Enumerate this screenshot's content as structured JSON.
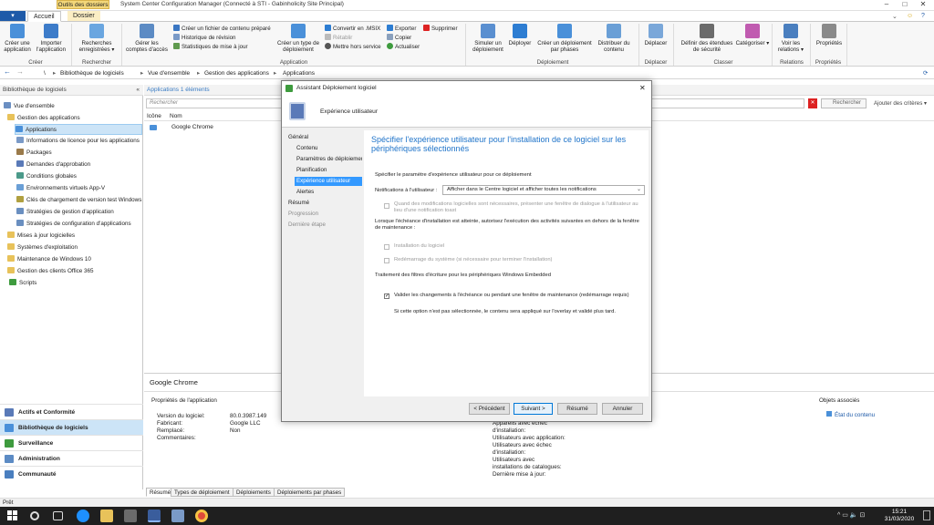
{
  "window": {
    "title": "System Center Configuration Manager (Connecté à STI - Gabinholicity Site Principal)",
    "contextual_tab_header": "Outils des dossiers",
    "controls": [
      "–",
      "□",
      "✕"
    ],
    "help_icons": [
      "⌄",
      "☺",
      "?"
    ]
  },
  "tabs": {
    "menu": "▾",
    "accueil": "Accueil",
    "dossier": "Dossier"
  },
  "ribbon": {
    "creer_application": "Créer une application",
    "importer_application": "Importer l'application",
    "recherches": "Recherches enregistrées ▾",
    "gerer_acces": "Gérer les comptes d'accès",
    "creer_fichier": "Créer un fichier de contenu préparé",
    "historique": "Historique de révision",
    "statistiques": "Statistiques de mise à jour",
    "creer_type": "Créer un type de déploiement",
    "convertir_msix": "Convertir en .MSIX",
    "retablir": "Rétablir",
    "mettre_hors_service": "Mettre hors service",
    "exporter": "Exporter",
    "copier": "Copier",
    "actualiser": "Actualiser",
    "supprimer": "Supprimer",
    "simuler": "Simuler un déploiement",
    "deployer": "Déployer",
    "creer_phases": "Créer un déploiement par phases",
    "distribuer": "Distribuer du contenu",
    "deplacer": "Déplacer",
    "definir_securite": "Définir des étendues de sécurité",
    "categoriser": "Catégoriser ▾",
    "voir_relations": "Voir les relations ▾",
    "proprietes": "Propriétés",
    "groups": {
      "creer": "Créer",
      "rechercher": "Rechercher",
      "application": "Application",
      "deploiement": "Déploiement",
      "deplacer": "Déplacer",
      "classer": "Classer",
      "relations": "Relations",
      "proprietes": "Propriétés"
    }
  },
  "address": {
    "back": "←",
    "forward": "→",
    "crumbs": [
      "\\",
      "Bibliothèque de logiciels",
      "Vue d'ensemble",
      "Gestion des applications",
      "Applications"
    ],
    "sep": "▸",
    "refresh": "⟳"
  },
  "nav": {
    "header": "Bibliothèque de logiciels",
    "collapse": "«",
    "tree": [
      "Vue d'ensemble",
      "Gestion des applications",
      "Applications",
      "Informations de licence pour les applications",
      "Packages",
      "Demandes d'approbation",
      "Conditions globales",
      "Environnements virtuels App-V",
      "Clés de chargement de version test Windows",
      "Stratégies de gestion d'application",
      "Stratégies de configuration d'applications",
      "Mises à jour logicielles",
      "Systèmes d'exploitation",
      "Maintenance de Windows 10",
      "Gestion des clients Office 365",
      "Scripts"
    ],
    "workspaces": [
      "Actifs et Conformité",
      "Bibliothèque de logiciels",
      "Surveillance",
      "Administration",
      "Communauté"
    ]
  },
  "main": {
    "header": "Applications 1 éléments",
    "search_placeholder": "Rechercher",
    "search_button": "Rechercher",
    "add_criteria": "Ajouter des critères ▾",
    "clear_icon": "✕",
    "columns": {
      "icone": "Icône",
      "nom": "Nom"
    },
    "rows": [
      {
        "name": "Google Chrome"
      }
    ]
  },
  "detail": {
    "title": "Google Chrome",
    "section": "Propriétés de l'application",
    "labels": [
      "Version du logiciel:",
      "Fabricant:",
      "Remplacé:",
      "Commentaires:"
    ],
    "values": [
      "80.0.3987.149",
      "Google LLC",
      "Non",
      ""
    ],
    "stats": [
      "Appareils avec échec",
      "d'installation:",
      "Utilisateurs avec application:",
      "Utilisateurs avec échec",
      "d'installation:",
      "Utilisateurs avec",
      "installations de catalogues:",
      "Dernière mise à jour:"
    ],
    "related_title": "Objets associés",
    "related_link": "État du contenu"
  },
  "bottom_tabs": [
    "Résumé",
    "Types de déploiement",
    "Déploiements",
    "Déploiements par phases"
  ],
  "status": "Prêt",
  "taskbar": {
    "time": "15:21",
    "date": "31/03/2020",
    "tray": "^  ▭  🔈  ⊡"
  },
  "dialog": {
    "title": "Assistant Déploiement logiciel",
    "close": "✕",
    "header": "Expérience utilisateur",
    "steps": [
      "Général",
      "Contenu",
      "Paramètres de déploiement",
      "Planification",
      "Expérience utilisateur",
      "Alertes",
      "Résumé",
      "Progression",
      "Dernière étape"
    ],
    "heading": "Spécifier l'expérience utilisateur pour l'installation de ce logiciel sur les périphériques sélectionnés",
    "spec_label": "Spécifier le paramètre d'expérience utilisateur pour ce déploiement",
    "notif_label": "Notifications à l'utilisateur :",
    "notif_value": "Afficher dans le Centre logiciel et afficher toutes les notifications",
    "cb_toast": "Quand des modifications logicielles sont nécessaires, présenter une fenêtre de dialogue à l'utilisateur au lieu d'une notification toast",
    "deadline_text": "Lorsque l'échéance d'installation est atteinte, autorisez l'exécution des activités suivantes en dehors de la fenêtre de maintenance :",
    "cb_install": "Installation du logiciel",
    "cb_restart": "Redémarrage du système (si nécessaire pour terminer l'installation)",
    "filter_text": "Traitement des filtres d'écriture pour les périphériques Windows Embedded",
    "cb_commit": "Valider les changements à l'échéance ou pendant une fenêtre de maintenance (redémarrage requis)",
    "overlay_text": "Si cette option n'est pas sélectionnée, le contenu sera appliqué sur l'overlay et validé plus tard.",
    "buttons": {
      "prev": "< Précédent",
      "next": "Suivant >",
      "summary": "Résumé",
      "cancel": "Annuler"
    }
  },
  "colors": {
    "accent": "#1e5aa8",
    "heading": "#1e73c9",
    "selection": "#3399ff",
    "tab_highlight": "#f3d77a"
  }
}
